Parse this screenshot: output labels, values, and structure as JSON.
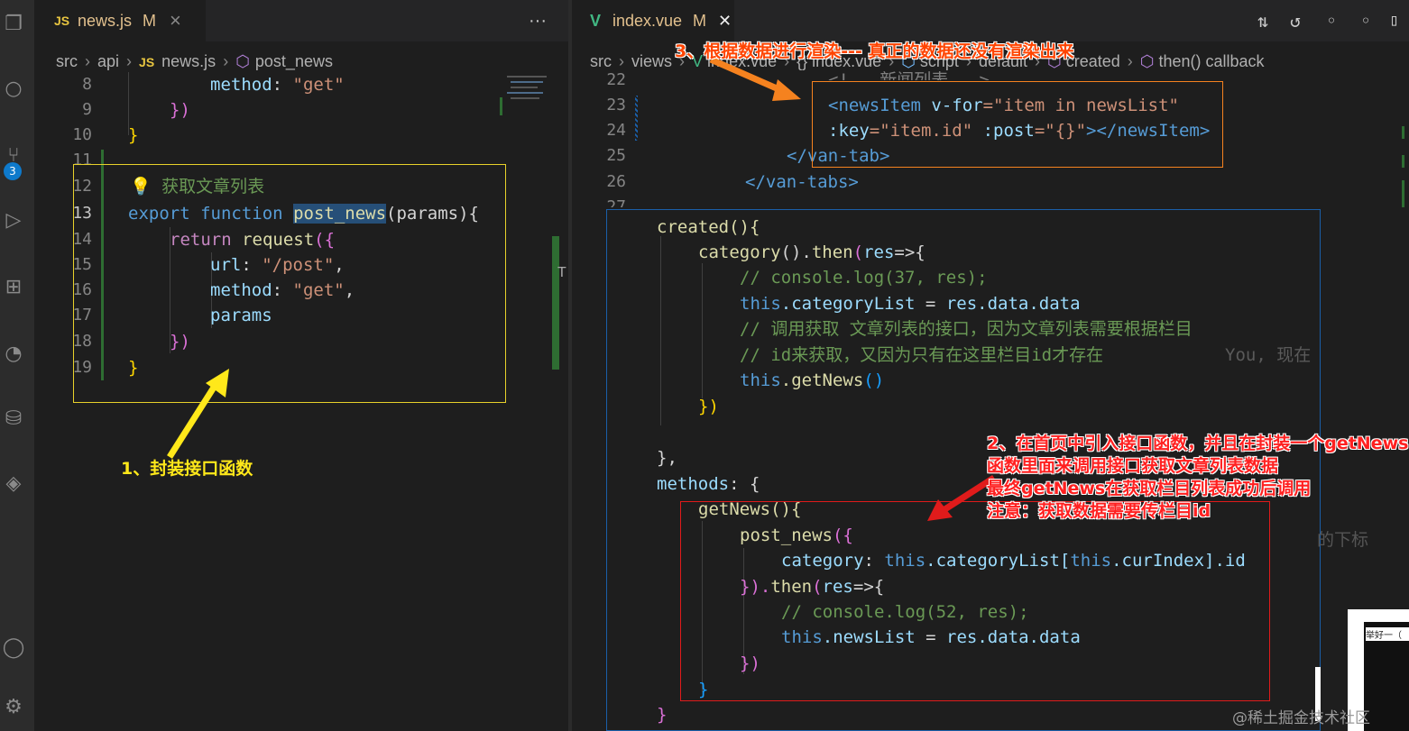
{
  "left_editor": {
    "tab": {
      "icon": "JS",
      "name": "news.js",
      "status": "M",
      "close": "×"
    },
    "more": "···",
    "breadcrumb": [
      "src",
      "api",
      "news.js",
      "post_news"
    ],
    "line_numbers": [
      "8",
      "9",
      "10",
      "11",
      "12",
      "13",
      "14",
      "15",
      "16",
      "17",
      "18",
      "19"
    ],
    "code": {
      "l8a": "method",
      "l8b": ": ",
      "l8c": "\"get\"",
      "l9": "})",
      "l10": "}",
      "l12": "获取文章列表",
      "l13a": "export",
      "l13b": "function",
      "l13c": "post_news",
      "l13d": "(params){",
      "l14a": "return",
      "l14b": "request",
      "l14c": "({",
      "l15a": "url",
      "l15b": ": ",
      "l15c": "\"/post\"",
      "l15d": ",",
      "l16a": "method",
      "l16b": ": ",
      "l16c": "\"get\"",
      "l16d": ",",
      "l17": "params",
      "l18": "})",
      "l19": "}"
    }
  },
  "right_editor": {
    "tab": {
      "name": "index.vue",
      "status": "M",
      "close": "✕"
    },
    "breadcrumb": [
      "src",
      "views",
      "index.vue",
      "{} index.vue",
      "script",
      "default",
      "created",
      "then() callback"
    ],
    "line_numbers": [
      "22",
      "23",
      "24",
      "25",
      "26",
      "27"
    ],
    "code": {
      "l22": "<!-- 新闻列表 -->",
      "l23a": "<newsItem",
      "l23b": "v-for",
      "l23c": "=\"item in newsList\"",
      "l24a": ":key",
      "l24b": "=\"item.id\"",
      "l24c": ":post",
      "l24d": "=\"{}\"",
      "l24e": "></newsItem>",
      "l25": "</van-tab>",
      "l26": "</van-tabs>",
      "c1": "created(){",
      "c2a": "category",
      "c2b": "().",
      "c2c": "then",
      "c2d": "(",
      "c2e": "res",
      "c2f": "=>{",
      "c3": "// console.log(37, res);",
      "c4a": "this",
      "c4b": ".categoryList",
      "c4c": " = ",
      "c4d": "res.data.data",
      "c5": "// 调用获取 文章列表的接口，因为文章列表需要根据栏目",
      "c6": "// id来获取，又因为只有在这里栏目id才存在",
      "c6b": "You, 现在",
      "c7a": "this",
      "c7b": ".getNews",
      "c7c": "()",
      "c8": "})",
      "c9": "},",
      "c10a": "methods",
      "c10b": ": {",
      "c11": "getNews(){",
      "c12a": "post_news",
      "c12b": "({",
      "c13a": "category",
      "c13b": ": ",
      "c13c": "this",
      "c13d": ".categoryList[",
      "c13e": "this",
      "c13f": ".curIndex].id",
      "c14a": "}).",
      "c14b": "then",
      "c14c": "(",
      "c14d": "res",
      "c14e": "=>{",
      "c15": "// console.log(52, res);",
      "c16a": "this",
      "c16b": ".newsList",
      "c16c": " = ",
      "c16d": "res.data.data",
      "c17": "})",
      "c18": "}",
      "c19": "}",
      "side_hint": "的下标"
    }
  },
  "annotations": {
    "a1": "1、封装接口函数",
    "a2_1": "2、在首页中引入接口函数，并且在封装一个getNews",
    "a2_2": "函数里面来调用接口获取文章列表数据",
    "a2_3": "最终getNews在获取栏目列表成功后调用",
    "a2_4": "注意：获取数据需要传栏目id",
    "a3": "3、根据数据进行渲染--- 真正的数据还没有渲染出来"
  },
  "overlay": {
    "thumb_label": "举好一（"
  },
  "watermark": "@稀土掘金技术社区",
  "activity_badge": "3",
  "colors": {
    "yellow_box": "#e8d12a",
    "orange_box": "#f5821f",
    "red_box": "#e01b1b",
    "blue_box": "#1b5fa8"
  }
}
